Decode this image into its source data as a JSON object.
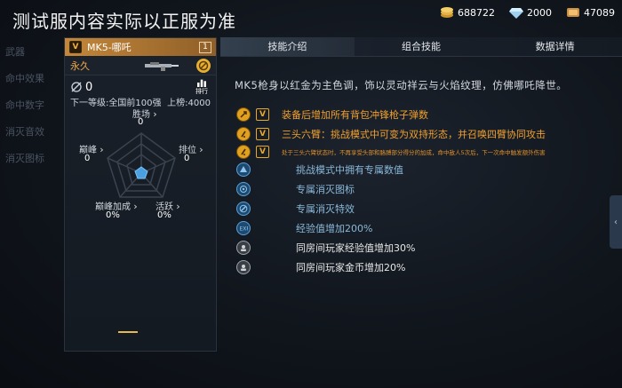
{
  "header": {
    "title": "测试服内容实际以正服为准",
    "currencies": [
      {
        "icon": "gold-coin-icon",
        "value": "688722"
      },
      {
        "icon": "diamond-icon",
        "value": "2000"
      },
      {
        "icon": "token-icon",
        "value": "47089"
      }
    ]
  },
  "leftnav": [
    "武器",
    "命中效果",
    "命中数字",
    "消灭音效",
    "消灭图标"
  ],
  "card": {
    "badge": "V",
    "weapon_name": "MK5-哪吒",
    "slot_number": "1",
    "duration": "永久",
    "kills": "0",
    "rank_label": "排行",
    "next_level": "下一等级:全国前100强",
    "rank_up": "上榜:4000",
    "radar": {
      "wins_label": "胜场",
      "wins_value": "0",
      "peak_label": "巅峰",
      "peak_value": "0",
      "rank_label": "排位",
      "rank_value": "0",
      "bonus_label": "巅峰加成",
      "bonus_value": "0%",
      "active_label": "活跃",
      "active_value": "0%"
    }
  },
  "tabs": [
    {
      "label": "技能介绍",
      "active": true
    },
    {
      "label": "组合技能",
      "active": false
    },
    {
      "label": "数据详情",
      "active": false
    }
  ],
  "description": "MK5枪身以红金为主色调，饰以灵动祥云与火焰纹理，仿佛哪吒降世。",
  "features": [
    {
      "icon": "gold-skill-icon",
      "v": true,
      "text": "装备后增加所有背包冲锋枪子弹数",
      "style": "orange"
    },
    {
      "icon": "gold-skill-icon",
      "v": true,
      "text": "三头六臂：挑战模式中可变为双持形态，并召唤四臂协同攻击",
      "style": "orange"
    },
    {
      "icon": "gold-skill-icon",
      "v": true,
      "text": "处于三头六臂状态时，不再享受头部和胳膊部分得分的加成，命中敌人5次后，下一次命中触发额外伤害",
      "style": "small"
    },
    {
      "icon": "blue-mode-icon",
      "v": false,
      "text": "挑战模式中拥有专属数值",
      "style": "blue"
    },
    {
      "icon": "blue-target-icon",
      "v": false,
      "text": "专属消灭图标",
      "style": "blue"
    },
    {
      "icon": "blue-effect-icon",
      "v": false,
      "text": "专属消灭特效",
      "style": "blue"
    },
    {
      "icon": "blue-exp-icon",
      "v": false,
      "text": "经验值增加200%",
      "style": "blue"
    },
    {
      "icon": "grey-exp-icon",
      "v": false,
      "text": "同房间玩家经验值增加30%",
      "style": "white"
    },
    {
      "icon": "grey-gold-icon",
      "v": false,
      "text": "同房间玩家金币增加20%",
      "style": "white"
    }
  ],
  "colors": {
    "accent": "#e0a020",
    "tab_active": "#34404e",
    "blue_text": "#8ab8d8"
  }
}
